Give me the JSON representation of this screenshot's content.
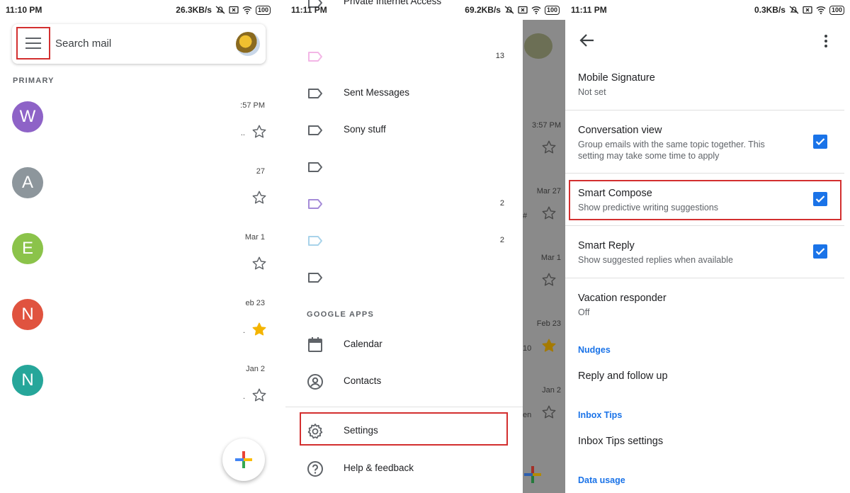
{
  "panel1": {
    "status": {
      "time": "11:10 PM",
      "speed": "26.3KB/s",
      "battery": "100"
    },
    "search": {
      "placeholder": "Search mail"
    },
    "section": "PRIMARY",
    "mails": [
      {
        "initial": "W",
        "color": "#8e63c7",
        "date": ":57 PM",
        "dot": "..",
        "starred": false
      },
      {
        "initial": "A",
        "color": "#8d969c",
        "date": "27",
        "dot": "",
        "starred": false
      },
      {
        "initial": "E",
        "color": "#8bc34a",
        "date": "Mar 1",
        "dot": "",
        "starred": false
      },
      {
        "initial": "N",
        "color": "#e0533f",
        "date": "eb 23",
        "dot": ".",
        "starred": true
      },
      {
        "initial": "N",
        "color": "#26a69a",
        "date": "Jan 2",
        "dot": ".",
        "starred": false
      }
    ]
  },
  "panel2": {
    "status": {
      "time": "11:11 PM",
      "speed": "69.2KB/s",
      "battery": "100"
    },
    "labels": [
      {
        "label": "Private Internet Access",
        "count": "",
        "color": "#5f6368"
      },
      {
        "label": "",
        "count": "13",
        "color": "#f3b6e6"
      },
      {
        "label": "Sent Messages",
        "count": "",
        "color": "#5f6368"
      },
      {
        "label": "Sony stuff",
        "count": "",
        "color": "#5f6368"
      },
      {
        "label": "",
        "count": "",
        "color": "#5f6368"
      },
      {
        "label": "",
        "count": "2",
        "color": "#a58bd8"
      },
      {
        "label": "",
        "count": "2",
        "color": "#a8d3ea"
      },
      {
        "label": "",
        "count": "",
        "color": "#5f6368"
      }
    ],
    "google_apps_header": "GOOGLE APPS",
    "apps": [
      {
        "label": "Calendar",
        "icon": "calendar-icon"
      },
      {
        "label": "Contacts",
        "icon": "contacts-icon"
      }
    ],
    "settings_label": "Settings",
    "help_label": "Help & feedback",
    "bg_dates": [
      "3:57 PM",
      "Mar 27",
      "Mar 1",
      "Feb 23",
      "Jan 2"
    ],
    "bg_snips": [
      "",
      "#",
      "",
      "10",
      "en"
    ]
  },
  "panel3": {
    "status": {
      "time": "11:11 PM",
      "speed": "0.3KB/s",
      "battery": "100"
    },
    "settings": [
      {
        "title": "Mobile Signature",
        "sub": "Not set",
        "checked": false
      },
      {
        "title": "Conversation view",
        "sub": "Group emails with the same topic together. This setting may take some time to apply",
        "checked": true
      },
      {
        "title": "Smart Compose",
        "sub": "Show predictive writing suggestions",
        "checked": true
      },
      {
        "title": "Smart Reply",
        "sub": "Show suggested replies when available",
        "checked": true
      },
      {
        "title": "Vacation responder",
        "sub": "Off",
        "checked": false
      }
    ],
    "nudges_header": "Nudges",
    "nudges_item": "Reply and follow up",
    "inbox_tips_header": "Inbox Tips",
    "inbox_tips_item": "Inbox Tips settings",
    "data_usage_header": "Data usage"
  },
  "colors": {
    "accent": "#1a73e8",
    "highlight": "#d32f2f",
    "star": "#f4b400"
  }
}
